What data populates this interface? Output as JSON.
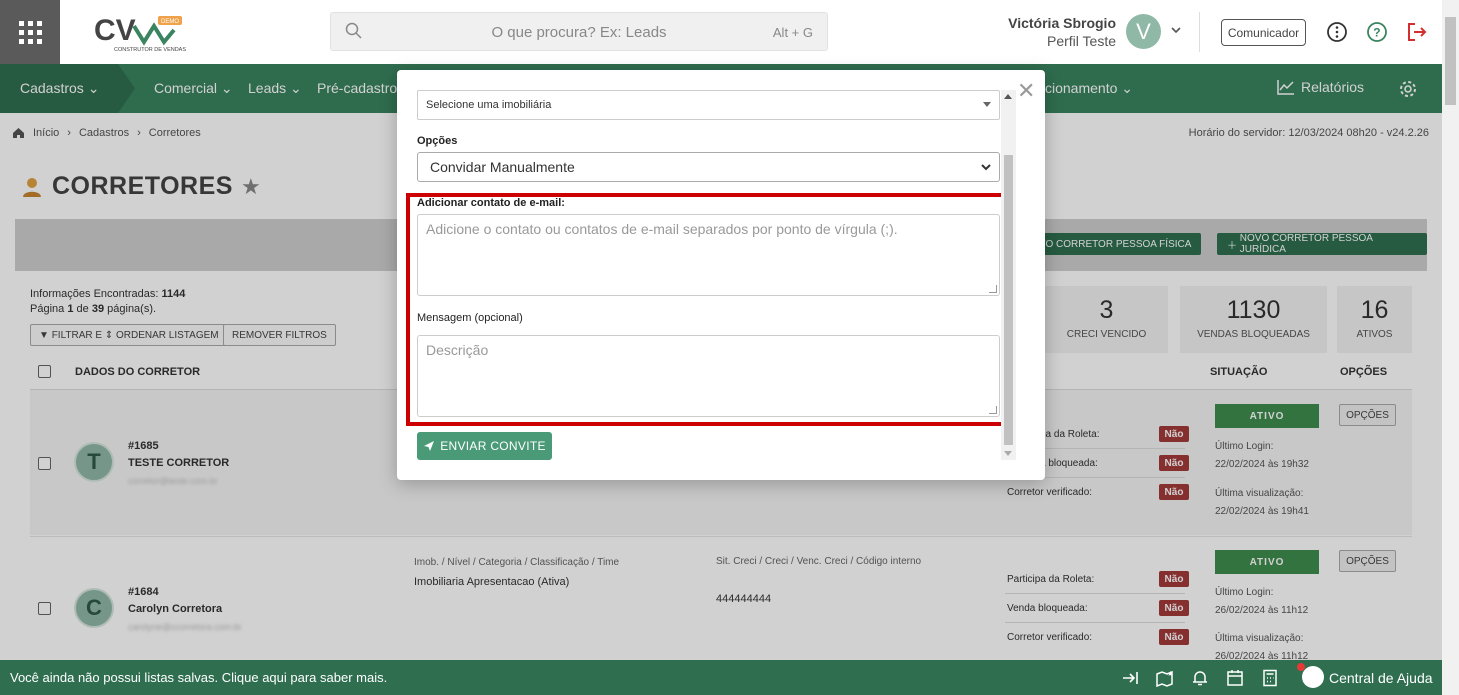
{
  "topbar": {
    "logo_text": "CV",
    "logo_badge": "DEMO",
    "logo_sub": "CONSTRUTOR DE VENDAS",
    "search_placeholder": "O que procura? Ex: Leads",
    "search_shortcut": "Alt + G",
    "user_name": "Victória Sbrogio",
    "user_role": "Perfil Teste",
    "user_initial": "V",
    "communicator_label": "Comunicador"
  },
  "nav": {
    "items": [
      "Cadastros",
      "Comercial",
      "Leads",
      "Pré-cadastros"
    ],
    "right_partial": "cionamento",
    "reports": "Relatórios"
  },
  "breadcrumb": [
    "Início",
    "Cadastros",
    "Corretores"
  ],
  "server_time": "Horário do servidor: 12/03/2024 08h20 - v24.2.26",
  "page_title": "CORRETORES",
  "actions": {
    "new_pf": "OVO CORRETOR PESSOA FÍSICA",
    "new_pj": "NOVO CORRETOR PESSOA JURÍDICA"
  },
  "info": {
    "found_label": "Informações Encontradas:",
    "found_count": "1144",
    "page_label_a": "Página",
    "page_num": "1",
    "page_label_b": "de",
    "page_total": "39",
    "page_label_c": "página(s)."
  },
  "filters": {
    "filter_btn": "FILTRAR E ⇕ ORDENAR LISTAGEM",
    "remove_btn": "REMOVER FILTROS"
  },
  "stats": [
    {
      "num": "3",
      "label": "CRECI VENCIDO"
    },
    {
      "num": "1130",
      "label": "VENDAS BLOQUEADAS"
    },
    {
      "num": "16",
      "label": "ATIVOS"
    }
  ],
  "table": {
    "col_dados": "DADOS DO CORRETOR",
    "col_situacao": "SITUAÇÃO",
    "col_opcoes": "OPÇÕES",
    "rows": [
      {
        "id": "#1685",
        "name": "TESTE CORRETOR",
        "initial": "T",
        "email": "corretor@teste.com.br",
        "flag1": "pa da Roleta:",
        "flag2": "a bloqueada:",
        "flag3": "Corretor verificado:",
        "no": "Não",
        "status": "ATIVO",
        "last_login_label": "Último Login:",
        "last_login": "22/02/2024 às 19h32",
        "last_view_label": "Última visualização:",
        "last_view": "22/02/2024 às 19h41",
        "options": "OPÇÕES"
      },
      {
        "id": "#1684",
        "name": "Carolyn Corretora",
        "initial": "C",
        "email": "carolyne@ccorretora.com.br",
        "imob_header": "Imob. / Nível / Categoria / Classificação / Time",
        "imob_value": "Imobiliaria Apresentacao (Ativa)",
        "creci_header": "Sit. Creci / Creci / Venc. Creci / Código interno",
        "creci_value": "444444444",
        "flag1": "Participa da Roleta:",
        "flag2": "Venda bloqueada:",
        "flag3": "Corretor verificado:",
        "no": "Não",
        "status": "ATIVO",
        "last_login_label": "Último Login:",
        "last_login": "26/02/2024 às 11h12",
        "last_view_label": "Última visualização:",
        "last_view": "26/02/2024 às 11h12",
        "options": "OPÇÕES"
      }
    ]
  },
  "bottombar": {
    "message": "Você ainda não possui listas salvas. Clique aqui para saber mais.",
    "help": "Central de Ajuda"
  },
  "modal": {
    "imob_select": "Selecione uma imobiliária",
    "options_label": "Opções",
    "options_value": "Convidar Manualmente",
    "email_label": "Adicionar contato de e-mail:",
    "email_placeholder": "Adicione o contato ou contatos de e-mail separados por ponto de vírgula (;).",
    "message_label": "Mensagem (opcional)",
    "message_placeholder": "Descrição",
    "send_label": "ENVIAR CONVITE"
  },
  "colors": {
    "brand_green": "#3a8460",
    "dark_green": "#2f6f50",
    "highlight_red": "#cc0000",
    "badge_red": "#a33a3a"
  }
}
